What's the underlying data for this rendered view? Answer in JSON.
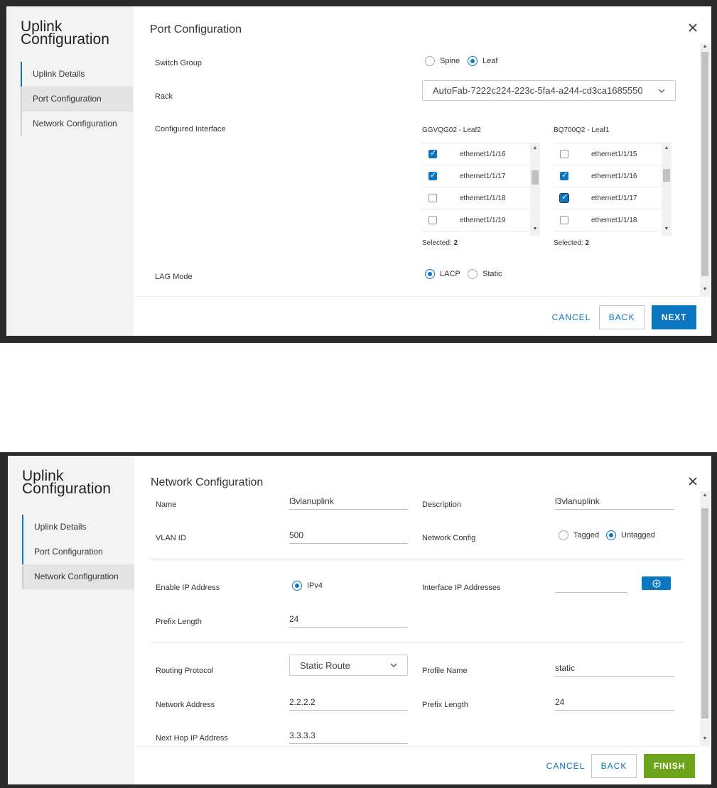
{
  "wizard1": {
    "sidebar_title": "Uplink\nConfiguration",
    "steps": [
      {
        "label": "Uplink Details"
      },
      {
        "label": "Port Configuration"
      },
      {
        "label": "Network Configuration"
      }
    ],
    "title": "Port Configuration",
    "switch_group": {
      "label": "Switch Group",
      "options": [
        "Spine",
        "Leaf"
      ],
      "selected": "Leaf"
    },
    "rack": {
      "label": "Rack",
      "value": "AutoFab-7222c224-223c-5fa4-a244-cd3ca1685550"
    },
    "configured_interface": {
      "label": "Configured Interface",
      "lists": [
        {
          "title": "GGVQG02 - Leaf2",
          "rows": [
            {
              "name": "ethernet1/1/16",
              "checked": true
            },
            {
              "name": "ethernet1/1/17",
              "checked": true
            },
            {
              "name": "ethernet1/1/18",
              "checked": false
            },
            {
              "name": "ethernet1/1/19",
              "checked": false
            }
          ],
          "selected_label": "Selected:",
          "selected_count": "2"
        },
        {
          "title": "BQ700Q2 - Leaf1",
          "rows": [
            {
              "name": "ethernet1/1/15",
              "checked": false
            },
            {
              "name": "ethernet1/1/16",
              "checked": true
            },
            {
              "name": "ethernet1/1/17",
              "checked": true
            },
            {
              "name": "ethernet1/1/18",
              "checked": false
            }
          ],
          "selected_label": "Selected:",
          "selected_count": "2"
        }
      ]
    },
    "lag_mode": {
      "label": "LAG Mode",
      "options": [
        "LACP",
        "Static"
      ],
      "selected": "LACP"
    },
    "buttons": {
      "cancel": "CANCEL",
      "back": "BACK",
      "next": "NEXT"
    }
  },
  "wizard2": {
    "sidebar_title": "Uplink\nConfiguration",
    "steps": [
      {
        "label": "Uplink Details"
      },
      {
        "label": "Port Configuration"
      },
      {
        "label": "Network Configuration"
      }
    ],
    "title": "Network Configuration",
    "name": {
      "label": "Name",
      "value": "l3vlanuplink"
    },
    "description": {
      "label": "Description",
      "value": "l3vlanuplink"
    },
    "vlan_id": {
      "label": "VLAN ID",
      "value": "500"
    },
    "network_config": {
      "label": "Network Config",
      "options": [
        "Tagged",
        "Untagged"
      ],
      "selected": "Untagged"
    },
    "enable_ip": {
      "label": "Enable IP Address",
      "option": "IPv4"
    },
    "interface_ip": {
      "label": "Interface IP Addresses",
      "value": "",
      "add_icon": "plus-circle-icon"
    },
    "prefix_length": {
      "label": "Prefix Length",
      "value": "24"
    },
    "routing_protocol": {
      "label": "Routing Protocol",
      "value": "Static Route"
    },
    "profile_name": {
      "label": "Profile Name",
      "value": "static"
    },
    "network_address": {
      "label": "Network Address",
      "value": "2.2.2.2"
    },
    "route_prefix_length": {
      "label": "Prefix Length",
      "value": "24"
    },
    "next_hop": {
      "label": "Next Hop IP Address",
      "value": "3.3.3.3"
    },
    "buttons": {
      "cancel": "CANCEL",
      "back": "BACK",
      "finish": "FINISH"
    }
  },
  "colors": {
    "accent": "#0b77c0",
    "finish": "#6da21b",
    "backdrop": "#2a2a2a",
    "sidebar": "#f3f3f3"
  }
}
